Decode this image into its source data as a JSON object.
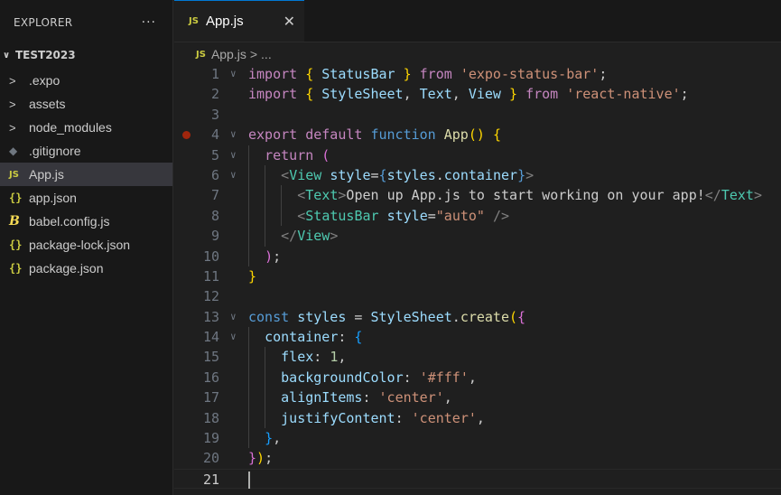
{
  "explorer": {
    "title": "EXPLORER",
    "more": "···",
    "root": "TEST2023",
    "items": [
      {
        "label": ".expo",
        "icon": "chevron-right-icon",
        "glyph": ">",
        "kind": "folder"
      },
      {
        "label": "assets",
        "icon": "chevron-right-icon",
        "glyph": ">",
        "kind": "folder"
      },
      {
        "label": "node_modules",
        "icon": "chevron-right-icon",
        "glyph": ">",
        "kind": "folder"
      },
      {
        "label": ".gitignore",
        "icon": "git-icon",
        "glyph": "◆",
        "kind": "git"
      },
      {
        "label": "App.js",
        "icon": "js-file-icon",
        "glyph": "JS",
        "kind": "js",
        "active": true
      },
      {
        "label": "app.json",
        "icon": "json-file-icon",
        "glyph": "{}",
        "kind": "json"
      },
      {
        "label": "babel.config.js",
        "icon": "babel-file-icon",
        "glyph": "B",
        "kind": "babel"
      },
      {
        "label": "package-lock.json",
        "icon": "json-file-icon",
        "glyph": "{}",
        "kind": "json"
      },
      {
        "label": "package.json",
        "icon": "json-file-icon",
        "glyph": "{}",
        "kind": "json"
      }
    ]
  },
  "tab": {
    "icon_text": "JS",
    "label": "App.js",
    "close": "✕"
  },
  "breadcrumb": {
    "icon_text": "JS",
    "file": "App.js",
    "sep": ">",
    "rest": "..."
  },
  "colors": {
    "accent": "#0078d4",
    "keyword": "#c586c0",
    "storage": "#569cd6",
    "string": "#ce9178",
    "function": "#dcdcaa",
    "variable": "#9cdcfe",
    "class": "#4ec9b0",
    "number": "#b5cea8",
    "tag": "#569cd6",
    "breakpoint": "#a1260d"
  },
  "code": {
    "lines": [
      {
        "n": "1",
        "fold": true,
        "indent": 0,
        "tokens": [
          [
            "import",
            "kw"
          ],
          [
            " ",
            ""
          ],
          [
            "{",
            "b1"
          ],
          [
            " ",
            ""
          ],
          [
            "StatusBar",
            "var"
          ],
          [
            " ",
            ""
          ],
          [
            "}",
            "b1"
          ],
          [
            " ",
            ""
          ],
          [
            "from",
            "kw"
          ],
          [
            " ",
            ""
          ],
          [
            "'expo-status-bar'",
            "str"
          ],
          [
            ";",
            ""
          ]
        ]
      },
      {
        "n": "2",
        "fold": false,
        "indent": 0,
        "tokens": [
          [
            "import",
            "kw"
          ],
          [
            " ",
            ""
          ],
          [
            "{",
            "b1"
          ],
          [
            " ",
            ""
          ],
          [
            "StyleSheet",
            "var"
          ],
          [
            ", ",
            ""
          ],
          [
            "Text",
            "var"
          ],
          [
            ", ",
            ""
          ],
          [
            "View",
            "var"
          ],
          [
            " ",
            ""
          ],
          [
            "}",
            "b1"
          ],
          [
            " ",
            ""
          ],
          [
            "from",
            "kw"
          ],
          [
            " ",
            ""
          ],
          [
            "'react-native'",
            "str"
          ],
          [
            ";",
            ""
          ]
        ]
      },
      {
        "n": "3",
        "fold": false,
        "indent": 0,
        "tokens": []
      },
      {
        "n": "4",
        "fold": true,
        "bp": true,
        "indent": 0,
        "tokens": [
          [
            "export",
            "kw"
          ],
          [
            " ",
            ""
          ],
          [
            "default",
            "kw"
          ],
          [
            " ",
            ""
          ],
          [
            "function",
            "st"
          ],
          [
            " ",
            ""
          ],
          [
            "App",
            "fn"
          ],
          [
            "()",
            "b1"
          ],
          [
            " ",
            ""
          ],
          [
            "{",
            "b1"
          ]
        ]
      },
      {
        "n": "5",
        "fold": true,
        "indent": 1,
        "tokens": [
          [
            "return",
            "kw"
          ],
          [
            " ",
            ""
          ],
          [
            "(",
            "b2"
          ]
        ]
      },
      {
        "n": "6",
        "fold": true,
        "indent": 2,
        "tokens": [
          [
            "<",
            "gr"
          ],
          [
            "View",
            "cls"
          ],
          [
            " ",
            ""
          ],
          [
            "style",
            "var"
          ],
          [
            "=",
            "fg"
          ],
          [
            "{",
            "st"
          ],
          [
            "styles",
            "var"
          ],
          [
            ".",
            ""
          ],
          [
            "container",
            "var"
          ],
          [
            "}",
            "st"
          ],
          [
            ">",
            "gr"
          ]
        ]
      },
      {
        "n": "7",
        "fold": false,
        "indent": 3,
        "tokens": [
          [
            "<",
            "gr"
          ],
          [
            "Text",
            "cls"
          ],
          [
            ">",
            "gr"
          ],
          [
            "Open up App.js to start working on your app!",
            ""
          ],
          [
            "</",
            "gr"
          ],
          [
            "Text",
            "cls"
          ],
          [
            ">",
            "gr"
          ]
        ]
      },
      {
        "n": "8",
        "fold": false,
        "indent": 3,
        "tokens": [
          [
            "<",
            "gr"
          ],
          [
            "StatusBar",
            "cls"
          ],
          [
            " ",
            ""
          ],
          [
            "style",
            "var"
          ],
          [
            "=",
            "fg"
          ],
          [
            "\"auto\"",
            "str"
          ],
          [
            " ",
            ""
          ],
          [
            "/>",
            "gr"
          ]
        ]
      },
      {
        "n": "9",
        "fold": false,
        "indent": 2,
        "tokens": [
          [
            "</",
            "gr"
          ],
          [
            "View",
            "cls"
          ],
          [
            ">",
            "gr"
          ]
        ]
      },
      {
        "n": "10",
        "fold": false,
        "indent": 1,
        "tokens": [
          [
            ")",
            "b2"
          ],
          [
            ";",
            ""
          ]
        ]
      },
      {
        "n": "11",
        "fold": false,
        "indent": 0,
        "tokens": [
          [
            "}",
            "b1"
          ]
        ]
      },
      {
        "n": "12",
        "fold": false,
        "indent": 0,
        "tokens": []
      },
      {
        "n": "13",
        "fold": true,
        "indent": 0,
        "tokens": [
          [
            "const",
            "st"
          ],
          [
            " ",
            ""
          ],
          [
            "styles",
            "var"
          ],
          [
            " = ",
            ""
          ],
          [
            "StyleSheet",
            "var"
          ],
          [
            ".",
            ""
          ],
          [
            "create",
            "fn"
          ],
          [
            "(",
            "b1"
          ],
          [
            "{",
            "b2"
          ]
        ]
      },
      {
        "n": "14",
        "fold": true,
        "indent": 1,
        "tokens": [
          [
            "container",
            "var"
          ],
          [
            ": ",
            ""
          ],
          [
            "{",
            "b3"
          ]
        ]
      },
      {
        "n": "15",
        "fold": false,
        "indent": 2,
        "tokens": [
          [
            "flex",
            "var"
          ],
          [
            ": ",
            ""
          ],
          [
            "1",
            "num"
          ],
          [
            ",",
            ""
          ]
        ]
      },
      {
        "n": "16",
        "fold": false,
        "indent": 2,
        "tokens": [
          [
            "backgroundColor",
            "var"
          ],
          [
            ": ",
            ""
          ],
          [
            "'#fff'",
            "str"
          ],
          [
            ",",
            ""
          ]
        ]
      },
      {
        "n": "17",
        "fold": false,
        "indent": 2,
        "tokens": [
          [
            "alignItems",
            "var"
          ],
          [
            ": ",
            ""
          ],
          [
            "'center'",
            "str"
          ],
          [
            ",",
            ""
          ]
        ]
      },
      {
        "n": "18",
        "fold": false,
        "indent": 2,
        "tokens": [
          [
            "justifyContent",
            "var"
          ],
          [
            ": ",
            ""
          ],
          [
            "'center'",
            "str"
          ],
          [
            ",",
            ""
          ]
        ]
      },
      {
        "n": "19",
        "fold": false,
        "indent": 1,
        "tokens": [
          [
            "}",
            "b3"
          ],
          [
            ",",
            ""
          ]
        ]
      },
      {
        "n": "20",
        "fold": false,
        "indent": 0,
        "tokens": [
          [
            "}",
            "b2"
          ],
          [
            ")",
            "b1"
          ],
          [
            ";",
            ""
          ]
        ]
      },
      {
        "n": "21",
        "fold": false,
        "indent": 0,
        "current": true,
        "tokens": []
      }
    ]
  }
}
